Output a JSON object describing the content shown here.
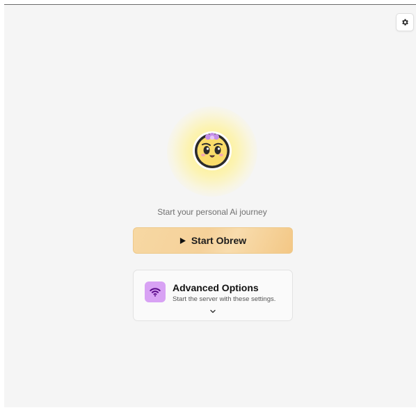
{
  "header": {
    "settings_icon": "gear-icon"
  },
  "hero": {
    "avatar_icon": "mascot-face-icon",
    "glow_color": "#fff07a",
    "tagline": "Start your personal Ai journey"
  },
  "start_button": {
    "label": "Start Obrew",
    "icon": "play-icon",
    "color": "#f5d19a"
  },
  "advanced_options": {
    "icon": "wifi-icon",
    "icon_bg": "#d8a2f4",
    "title": "Advanced Options",
    "subtitle": "Start the server with these settings.",
    "expand_icon": "chevron-down-icon",
    "expanded": false
  }
}
